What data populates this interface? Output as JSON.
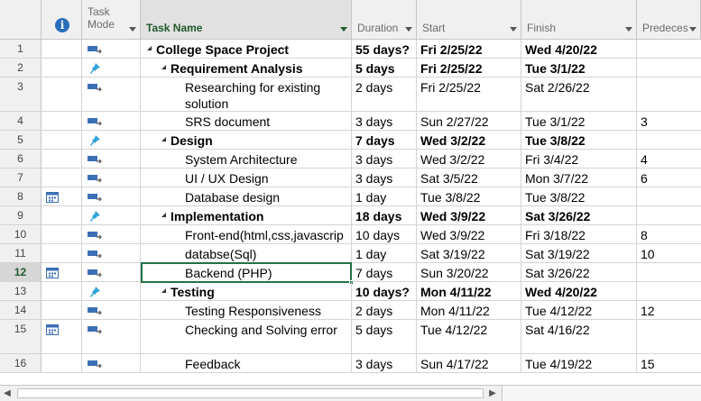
{
  "columns": {
    "info_symbol": "i",
    "task_mode_line1": "Task",
    "task_mode_line2": "Mode",
    "task_name": "Task Name",
    "duration": "Duration",
    "start": "Start",
    "finish": "Finish",
    "predecessors": "Predeces"
  },
  "colors": {
    "accent": "#217346",
    "header_green": "#215a2e",
    "info_blue": "#2a6ebb",
    "auto_icon": "#3b6fb6",
    "pin_icon": "#2ea4d6"
  },
  "tasks": [
    {
      "id": "1",
      "mode": "auto-scheduled-icon",
      "name": "College Space Project",
      "duration": "55 days?",
      "start": "Fri 2/25/22",
      "finish": "Wed 4/20/22",
      "pred": "",
      "level": 0,
      "summary": true,
      "info": ""
    },
    {
      "id": "2",
      "mode": "manually-scheduled-icon",
      "name": "Requirement Analysis",
      "duration": "5 days",
      "start": "Fri 2/25/22",
      "finish": "Tue 3/1/22",
      "pred": "",
      "level": 1,
      "summary": true,
      "info": ""
    },
    {
      "id": "3",
      "mode": "auto-scheduled-icon",
      "name": "Researching for existing solution",
      "duration": "2 days",
      "start": "Fri 2/25/22",
      "finish": "Sat 2/26/22",
      "pred": "",
      "level": 2,
      "summary": false,
      "info": ""
    },
    {
      "id": "4",
      "mode": "auto-scheduled-icon",
      "name": "SRS document",
      "duration": "3 days",
      "start": "Sun 2/27/22",
      "finish": "Tue 3/1/22",
      "pred": "3",
      "level": 2,
      "summary": false,
      "info": ""
    },
    {
      "id": "5",
      "mode": "manually-scheduled-icon",
      "name": "Design",
      "duration": "7 days",
      "start": "Wed 3/2/22",
      "finish": "Tue 3/8/22",
      "pred": "",
      "level": 1,
      "summary": true,
      "info": ""
    },
    {
      "id": "6",
      "mode": "auto-scheduled-icon",
      "name": "System Architecture",
      "duration": "3 days",
      "start": "Wed 3/2/22",
      "finish": "Fri 3/4/22",
      "pred": "4",
      "level": 2,
      "summary": false,
      "info": ""
    },
    {
      "id": "7",
      "mode": "auto-scheduled-icon",
      "name": "UI / UX Design",
      "duration": "3 days",
      "start": "Sat 3/5/22",
      "finish": "Mon 3/7/22",
      "pred": "6",
      "level": 2,
      "summary": false,
      "info": ""
    },
    {
      "id": "8",
      "mode": "auto-scheduled-icon",
      "name": "Database design",
      "duration": "1 day",
      "start": "Tue 3/8/22",
      "finish": "Tue 3/8/22",
      "pred": "",
      "level": 2,
      "summary": false,
      "info": "calendar-constraint-icon"
    },
    {
      "id": "9",
      "mode": "manually-scheduled-icon",
      "name": "Implementation",
      "duration": "18 days",
      "start": "Wed 3/9/22",
      "finish": "Sat 3/26/22",
      "pred": "",
      "level": 1,
      "summary": true,
      "info": ""
    },
    {
      "id": "10",
      "mode": "auto-scheduled-icon",
      "name": "Front-end(html,css,javascrip",
      "duration": "10 days",
      "start": "Wed 3/9/22",
      "finish": "Fri 3/18/22",
      "pred": "8",
      "level": 2,
      "summary": false,
      "info": ""
    },
    {
      "id": "11",
      "mode": "auto-scheduled-icon",
      "name": "databse(Sql)",
      "duration": "1 day",
      "start": "Sat 3/19/22",
      "finish": "Sat 3/19/22",
      "pred": "10",
      "level": 2,
      "summary": false,
      "info": ""
    },
    {
      "id": "12",
      "mode": "auto-scheduled-icon",
      "name": "Backend (PHP)",
      "duration": "7 days",
      "start": "Sun 3/20/22",
      "finish": "Sat 3/26/22",
      "pred": "",
      "level": 2,
      "summary": false,
      "info": "calendar-constraint-icon"
    },
    {
      "id": "13",
      "mode": "manually-scheduled-icon",
      "name": "Testing",
      "duration": "10 days?",
      "start": "Mon 4/11/22",
      "finish": "Wed 4/20/22",
      "pred": "",
      "level": 1,
      "summary": true,
      "info": ""
    },
    {
      "id": "14",
      "mode": "auto-scheduled-icon",
      "name": "Testing Responsiveness",
      "duration": "2 days",
      "start": "Mon 4/11/22",
      "finish": "Tue 4/12/22",
      "pred": "12",
      "level": 2,
      "summary": false,
      "info": ""
    },
    {
      "id": "15",
      "mode": "auto-scheduled-icon",
      "name": "Checking and Solving error",
      "duration": "5 days",
      "start": "Tue 4/12/22",
      "finish": "Sat 4/16/22",
      "pred": "",
      "level": 2,
      "summary": false,
      "info": "calendar-constraint-icon"
    },
    {
      "id": "16",
      "mode": "auto-scheduled-icon",
      "name": "Feedback",
      "duration": "3 days",
      "start": "Sun 4/17/22",
      "finish": "Tue 4/19/22",
      "pred": "15",
      "level": 2,
      "summary": false,
      "info": ""
    }
  ],
  "selected_row": "12"
}
